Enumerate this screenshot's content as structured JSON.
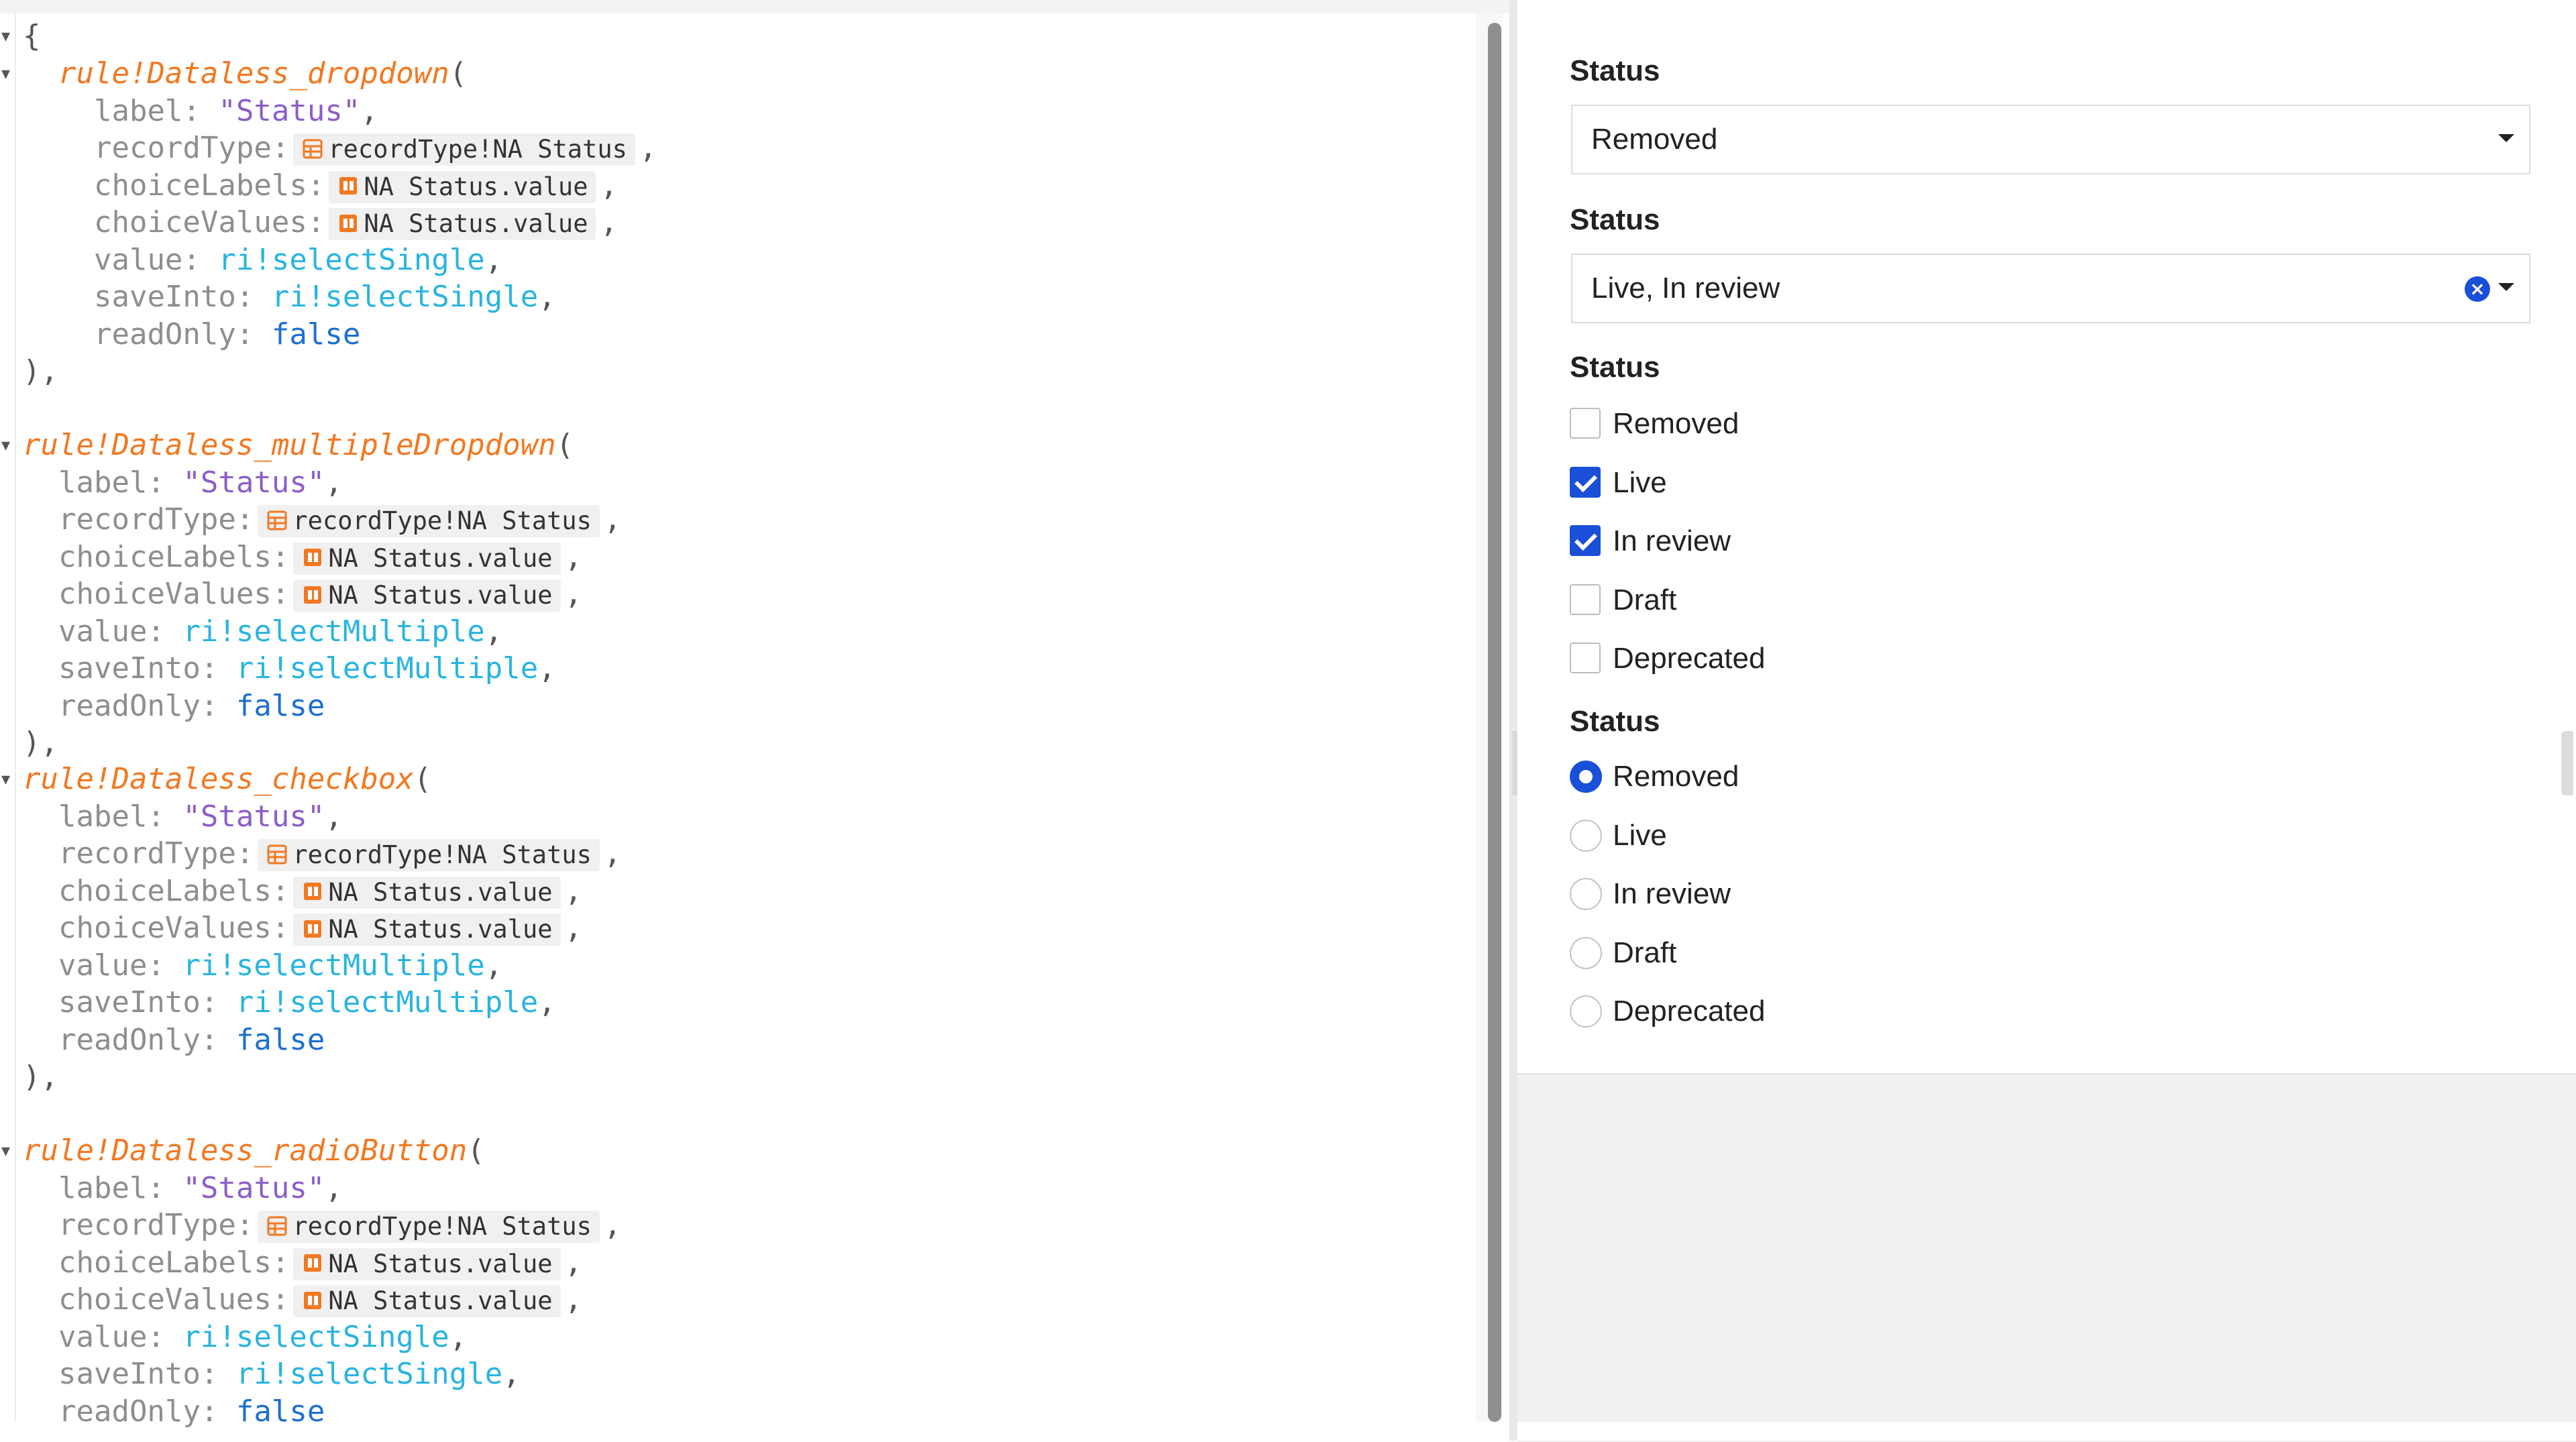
{
  "code": {
    "open_brace": "{",
    "blocks": [
      {
        "rule": "rule!Dataless_dropdown",
        "label_key": "label:",
        "label_val": "\"Status\"",
        "recordType_key": "recordType:",
        "recordType_chip": "recordType!NA Status",
        "choiceLabels_key": "choiceLabels:",
        "choiceLabels_chip": "NA Status.value",
        "choiceValues_key": "choiceValues:",
        "choiceValues_chip": "NA Status.value",
        "value_key": "value:",
        "value_val": "ri!selectSingle",
        "saveInto_key": "saveInto:",
        "saveInto_val": "ri!selectSingle",
        "readOnly_key": "readOnly:",
        "readOnly_val": "false",
        "close": "),"
      },
      {
        "rule": "rule!Dataless_multipleDropdown",
        "label_key": "label:",
        "label_val": "\"Status\"",
        "recordType_key": "recordType:",
        "recordType_chip": "recordType!NA Status",
        "choiceLabels_key": "choiceLabels:",
        "choiceLabels_chip": "NA Status.value",
        "choiceValues_key": "choiceValues:",
        "choiceValues_chip": "NA Status.value",
        "value_key": "value:",
        "value_val": "ri!selectMultiple",
        "saveInto_key": "saveInto:",
        "saveInto_val": "ri!selectMultiple",
        "readOnly_key": "readOnly:",
        "readOnly_val": "false",
        "close": "),"
      },
      {
        "rule": "rule!Dataless_checkbox",
        "label_key": "label:",
        "label_val": "\"Status\"",
        "recordType_key": "recordType:",
        "recordType_chip": "recordType!NA Status",
        "choiceLabels_key": "choiceLabels:",
        "choiceLabels_chip": "NA Status.value",
        "choiceValues_key": "choiceValues:",
        "choiceValues_chip": "NA Status.value",
        "value_key": "value:",
        "value_val": "ri!selectMultiple",
        "saveInto_key": "saveInto:",
        "saveInto_val": "ri!selectMultiple",
        "readOnly_key": "readOnly:",
        "readOnly_val": "false",
        "close": "),"
      },
      {
        "rule": "rule!Dataless_radioButton",
        "label_key": "label:",
        "label_val": "\"Status\"",
        "recordType_key": "recordType:",
        "recordType_chip": "recordType!NA Status",
        "choiceLabels_key": "choiceLabels:",
        "choiceLabels_chip": "NA Status.value",
        "choiceValues_key": "choiceValues:",
        "choiceValues_chip": "NA Status.value",
        "value_key": "value:",
        "value_val": "ri!selectSingle",
        "saveInto_key": "saveInto:",
        "saveInto_val": "ri!selectSingle",
        "readOnly_key": "readOnly:",
        "readOnly_val": "false",
        "close": ""
      }
    ]
  },
  "preview": {
    "dropdown": {
      "label": "Status",
      "value": "Removed"
    },
    "multi_dropdown": {
      "label": "Status",
      "value": "Live, In review"
    },
    "checkbox": {
      "label": "Status",
      "options": [
        {
          "label": "Removed",
          "checked": false
        },
        {
          "label": "Live",
          "checked": true
        },
        {
          "label": "In review",
          "checked": true
        },
        {
          "label": "Draft",
          "checked": false
        },
        {
          "label": "Deprecated",
          "checked": false
        }
      ]
    },
    "radio": {
      "label": "Status",
      "options": [
        {
          "label": "Removed",
          "selected": true
        },
        {
          "label": "Live",
          "selected": false
        },
        {
          "label": "In review",
          "selected": false
        },
        {
          "label": "Draft",
          "selected": false
        },
        {
          "label": "Deprecated",
          "selected": false
        }
      ]
    }
  },
  "colors": {
    "accent": "#1a4fd8",
    "rule_name": "#f27821",
    "string": "#8c5ec7",
    "rule_input": "#2ab4e0",
    "keyword": "#1d6fcf"
  },
  "icons": [
    "record-type-icon",
    "clear-selection-icon",
    "chevron-down-icon",
    "collapse-left-icon"
  ]
}
